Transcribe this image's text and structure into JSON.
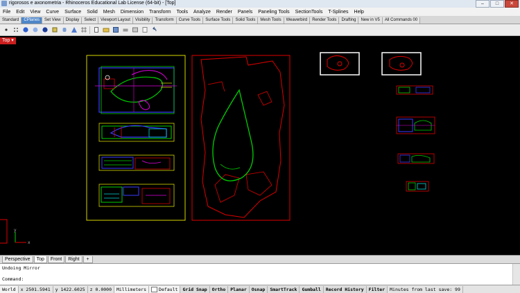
{
  "window": {
    "title": "rigorosos e axonometria - Rhinoceros Educational Lab License (64-bit) - [Top]",
    "controls": [
      "–",
      "□",
      "✕"
    ]
  },
  "menu": [
    "File",
    "Edit",
    "View",
    "Curve",
    "Surface",
    "Solid",
    "Mesh",
    "Dimension",
    "Transform",
    "Tools",
    "Analyze",
    "Render",
    "Panels",
    "Paneling Tools",
    "SectionTools",
    "T-Splines",
    "Help"
  ],
  "toolbar_tabs": {
    "items": [
      "Standard",
      "CPlanes",
      "Set View",
      "Display",
      "Select",
      "Viewport Layout",
      "Visibility",
      "Transform",
      "Curve Tools",
      "Surface Tools",
      "Solid Tools",
      "Mesh Tools",
      "Weaverbird",
      "Render Tools",
      "Drafting",
      "New in V5",
      "All Commands 00"
    ],
    "active": "CPlanes"
  },
  "viewport": {
    "name": "Top",
    "dropdown": "▾"
  },
  "viewport_tabs": [
    "Perspective",
    "Top",
    "Front",
    "Right",
    "+"
  ],
  "command": {
    "history": "Undoing Mirror",
    "prompt": "Command:",
    "value": ""
  },
  "status": {
    "cplane": "World",
    "x": "x 2501.5941",
    "y": "y 1422.6025",
    "z": "z 0.0000",
    "units": "Millimeters",
    "layer": "Default",
    "buttons": [
      "Grid Snap",
      "Ortho",
      "Planar",
      "Osnap",
      "SmartTrack",
      "Gumball",
      "Record History",
      "Filter"
    ],
    "save": "Minutes from last save: 99"
  },
  "colors": {
    "yellow": "#d8d800",
    "red": "#e00000",
    "green": "#00d000",
    "blue": "#3a3aff",
    "magenta": "#e000e0",
    "cyan": "#00d8d8",
    "white": "#ffffff"
  }
}
